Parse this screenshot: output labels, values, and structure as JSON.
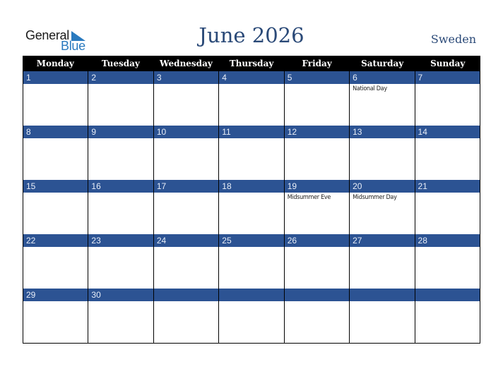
{
  "logo": {
    "word1": "General",
    "word2": "Blue"
  },
  "header": {
    "title": "June 2026",
    "country": "Sweden"
  },
  "weekdays": [
    "Monday",
    "Tuesday",
    "Wednesday",
    "Thursday",
    "Friday",
    "Saturday",
    "Sunday"
  ],
  "weeks": [
    [
      {
        "day": "1",
        "holiday": ""
      },
      {
        "day": "2",
        "holiday": ""
      },
      {
        "day": "3",
        "holiday": ""
      },
      {
        "day": "4",
        "holiday": ""
      },
      {
        "day": "5",
        "holiday": ""
      },
      {
        "day": "6",
        "holiday": "National Day"
      },
      {
        "day": "7",
        "holiday": ""
      }
    ],
    [
      {
        "day": "8",
        "holiday": ""
      },
      {
        "day": "9",
        "holiday": ""
      },
      {
        "day": "10",
        "holiday": ""
      },
      {
        "day": "11",
        "holiday": ""
      },
      {
        "day": "12",
        "holiday": ""
      },
      {
        "day": "13",
        "holiday": ""
      },
      {
        "day": "14",
        "holiday": ""
      }
    ],
    [
      {
        "day": "15",
        "holiday": ""
      },
      {
        "day": "16",
        "holiday": ""
      },
      {
        "day": "17",
        "holiday": ""
      },
      {
        "day": "18",
        "holiday": ""
      },
      {
        "day": "19",
        "holiday": "Midsummer Eve"
      },
      {
        "day": "20",
        "holiday": "Midsummer Day"
      },
      {
        "day": "21",
        "holiday": ""
      }
    ],
    [
      {
        "day": "22",
        "holiday": ""
      },
      {
        "day": "23",
        "holiday": ""
      },
      {
        "day": "24",
        "holiday": ""
      },
      {
        "day": "25",
        "holiday": ""
      },
      {
        "day": "26",
        "holiday": ""
      },
      {
        "day": "27",
        "holiday": ""
      },
      {
        "day": "28",
        "holiday": ""
      }
    ],
    [
      {
        "day": "29",
        "holiday": ""
      },
      {
        "day": "30",
        "holiday": ""
      },
      {
        "day": "",
        "holiday": ""
      },
      {
        "day": "",
        "holiday": ""
      },
      {
        "day": "",
        "holiday": ""
      },
      {
        "day": "",
        "holiday": ""
      },
      {
        "day": "",
        "holiday": ""
      }
    ]
  ],
  "colors": {
    "header_bg": "#000000",
    "day_strip": "#2c5393",
    "title": "#2b4a78",
    "logo_blue": "#2a7abf"
  }
}
